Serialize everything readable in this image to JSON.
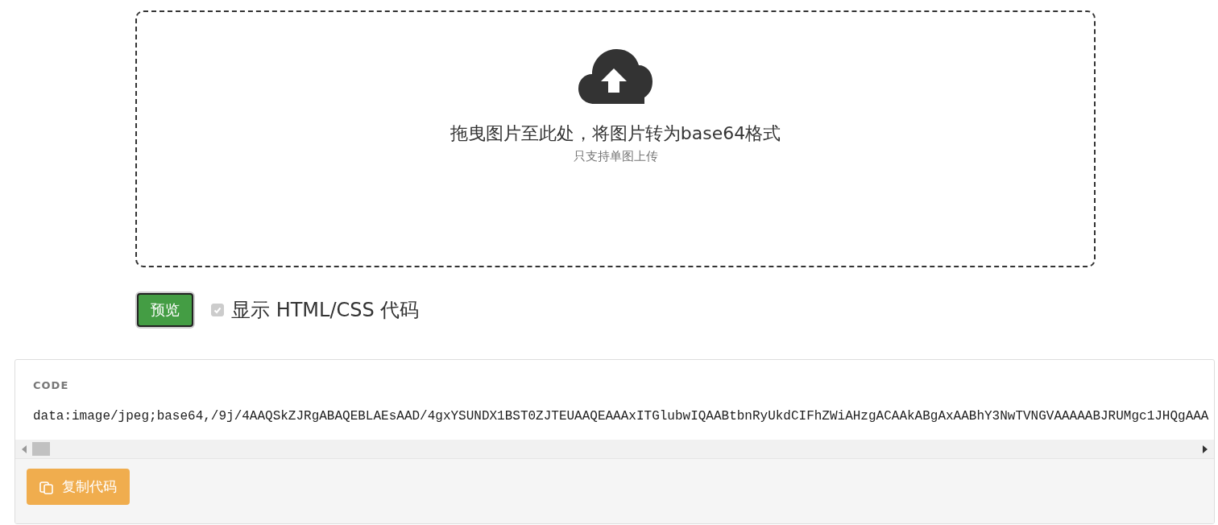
{
  "dropzone": {
    "title": "拖曳图片至此处，将图片转为base64格式",
    "subtitle": "只支持单图上传"
  },
  "controls": {
    "preview_button": "预览",
    "show_code": {
      "label": "显示 HTML/CSS 代码",
      "checked": true,
      "disabled": true
    }
  },
  "code_panel": {
    "heading": "CODE",
    "code": "data:image/jpeg;base64,/9j/4AAQSkZJRgABAQEBLAEsAAD/4gxYSUNDX1BST0ZJTEUAAQEAAAxITGlubwIQAABtbnRyUkdCIFhZWiAHzgACAAkABgAxAABhY3NwTVNGVAAAAABJRUMgc1JHQgAAA",
    "copy_button": "复制代码"
  }
}
